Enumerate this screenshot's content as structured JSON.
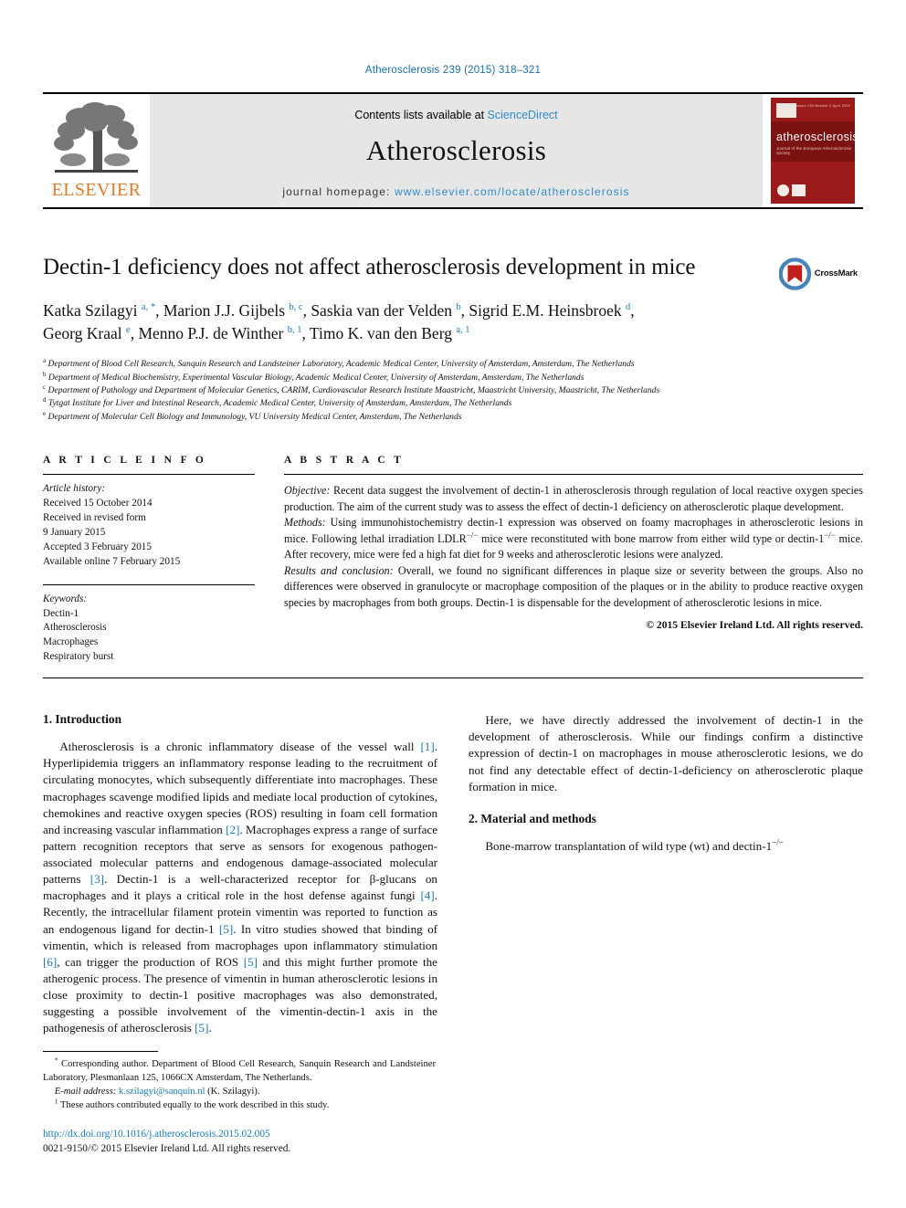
{
  "running_head": "Atherosclerosis 239 (2015) 318–321",
  "masthead": {
    "publisher_name": "ELSEVIER",
    "contents_prefix": "Contents lists available at ",
    "contents_link": "ScienceDirect",
    "journal_name": "Atherosclerosis",
    "homepage_label": "journal homepage:",
    "homepage_url": "www.elsevier.com/locate/atherosclerosis",
    "cover_title": "atherosclerosis",
    "cover_subtitle": "Journal of the European Atherosclerosis Society",
    "cover_toplines": "Volume 239  Number 2  April 2015"
  },
  "title": "Dectin-1 deficiency does not affect atherosclerosis development in mice",
  "crossmark_label": "CrossMark",
  "authors_line_1": "Katka Szilagyi a, *, Marion J.J. Gijbels b, c, Saskia van der Velden b, Sigrid E.M. Heinsbroek d,",
  "authors_line_2": "Georg Kraal e, Menno P.J. de Winther b, 1, Timo K. van den Berg a, 1",
  "affiliations": [
    {
      "mark": "a",
      "text": "Department of Blood Cell Research, Sanquin Research and Landsteiner Laboratory, Academic Medical Center, University of Amsterdam, Amsterdam, The Netherlands"
    },
    {
      "mark": "b",
      "text": "Department of Medical Biochemistry, Experimental Vascular Biology, Academic Medical Center, University of Amsterdam, Amsterdam, The Netherlands"
    },
    {
      "mark": "c",
      "text": "Department of Pathology and Department of Molecular Genetics, CARIM, Cardiovascular Research Institute Maastricht, Maastricht University, Maastricht, The Netherlands"
    },
    {
      "mark": "d",
      "text": "Tytgat Institute for Liver and Intestinal Research, Academic Medical Center, University of Amsterdam, Amsterdam, The Netherlands"
    },
    {
      "mark": "e",
      "text": "Department of Molecular Cell Biology and Immunology, VU University Medical Center, Amsterdam, The Netherlands"
    }
  ],
  "article_info": {
    "heading": "A R T I C L E  I N F O",
    "history_label": "Article history:",
    "history": [
      "Received 15 October 2014",
      "Received in revised form",
      "9 January 2015",
      "Accepted 3 February 2015",
      "Available online 7 February 2015"
    ],
    "keywords_label": "Keywords:",
    "keywords": [
      "Dectin-1",
      "Atherosclerosis",
      "Macrophages",
      "Respiratory burst"
    ]
  },
  "abstract": {
    "heading": "A B S T R A C T",
    "objective_label": "Objective:",
    "objective_text": " Recent data suggest the involvement of dectin-1 in atherosclerosis through regulation of local reactive oxygen species production. The aim of the current study was to assess the effect of dectin-1 deficiency on atherosclerotic plaque development.",
    "methods_label": "Methods:",
    "methods_text_a": " Using immunohistochemistry dectin-1 expression was observed on foamy macrophages in atherosclerotic lesions in mice. Following lethal irradiation LDLR",
    "methods_sup_1": "−/−",
    "methods_text_b": " mice were reconstituted with bone marrow from either wild type or dectin-1",
    "methods_sup_2": "−/−",
    "methods_text_c": " mice. After recovery, mice were fed a high fat diet for 9 weeks and atherosclerotic lesions were analyzed.",
    "results_label": "Results and conclusion:",
    "results_text": " Overall, we found no significant differences in plaque size or severity between the groups. Also no differences were observed in granulocyte or macrophage composition of the plaques or in the ability to produce reactive oxygen species by macrophages from both groups. Dectin-1 is dispensable for the development of atherosclerotic lesions in mice.",
    "copyright": "© 2015 Elsevier Ireland Ltd. All rights reserved."
  },
  "sections": {
    "introduction_heading": "1. Introduction",
    "intro_p1_a": "Atherosclerosis is a chronic inflammatory disease of the vessel wall ",
    "intro_ref1": "[1]",
    "intro_p1_b": ". Hyperlipidemia triggers an inflammatory response leading to the recruitment of circulating monocytes, which subsequently differentiate into macrophages. These macrophages scavenge modified lipids and mediate local production of cytokines, chemokines and reactive oxygen species (ROS) resulting in foam cell formation and increasing vascular inflammation ",
    "intro_ref2": "[2]",
    "intro_p1_c": ". Macrophages express a range of surface pattern recognition receptors that serve as sensors for exogenous pathogen-associated molecular patterns and endogenous damage-associated molecular patterns ",
    "intro_ref3": "[3]",
    "intro_p1_d": ". Dectin-1 is a well-characterized receptor for β-glucans on macrophages and it plays a critical role in the host defense against fungi ",
    "intro_ref4": "[4]",
    "intro_p1_e": ". Recently, the intracellular filament protein vimentin was reported to function as an endogenous ligand for dectin-1 ",
    "intro_ref5": "[5]",
    "intro_p1_f": ". In vitro studies showed that binding of vimentin, which is released from macrophages upon inflammatory stimulation ",
    "intro_ref6": "[6]",
    "intro_p1_g": ", can trigger the production of ROS ",
    "intro_ref7": "[5]",
    "intro_p1_h": " and this might further promote the atherogenic process. The presence of vimentin in human atherosclerotic lesions in close proximity to dectin-1 positive macrophages was also demonstrated, suggesting a possible involvement of the vimentin-dectin-1 axis in the pathogenesis of atherosclerosis ",
    "intro_ref8": "[5]",
    "intro_p1_i": ".",
    "intro_p2": "Here, we have directly addressed the involvement of dectin-1 in the development of atherosclerosis. While our findings confirm a distinctive expression of dectin-1 on macrophages in mouse atherosclerotic lesions, we do not find any detectable effect of dectin-1-deficiency on atherosclerotic plaque formation in mice.",
    "methods_heading": "2. Material and methods",
    "methods_p1_a": "Bone-marrow transplantation of wild type (wt) and dectin-1",
    "methods_p1_sup": "−/−"
  },
  "footnotes": {
    "corresponding_mark": "*",
    "corresponding_text": " Corresponding author. Department of Blood Cell Research, Sanquin Research and Landsteiner Laboratory, Plesmanlaan 125, 1066CX Amsterdam, The Netherlands.",
    "email_label": "E-mail address:",
    "email_address": "k.szilagyi@sanquin.nl",
    "email_suffix": " (K. Szilagyi).",
    "equal_mark": "1",
    "equal_text": " These authors contributed equally to the work described in this study.",
    "doi": "http://dx.doi.org/10.1016/j.atherosclerosis.2015.02.005",
    "issn": "0021-9150/© 2015 Elsevier Ireland Ltd. All rights reserved."
  },
  "colors": {
    "link_blue": "#1a7ab5",
    "sciencedirect_blue": "#2e8bc9",
    "elsevier_orange": "#E87722",
    "cover_red": "#9b1b1b"
  }
}
